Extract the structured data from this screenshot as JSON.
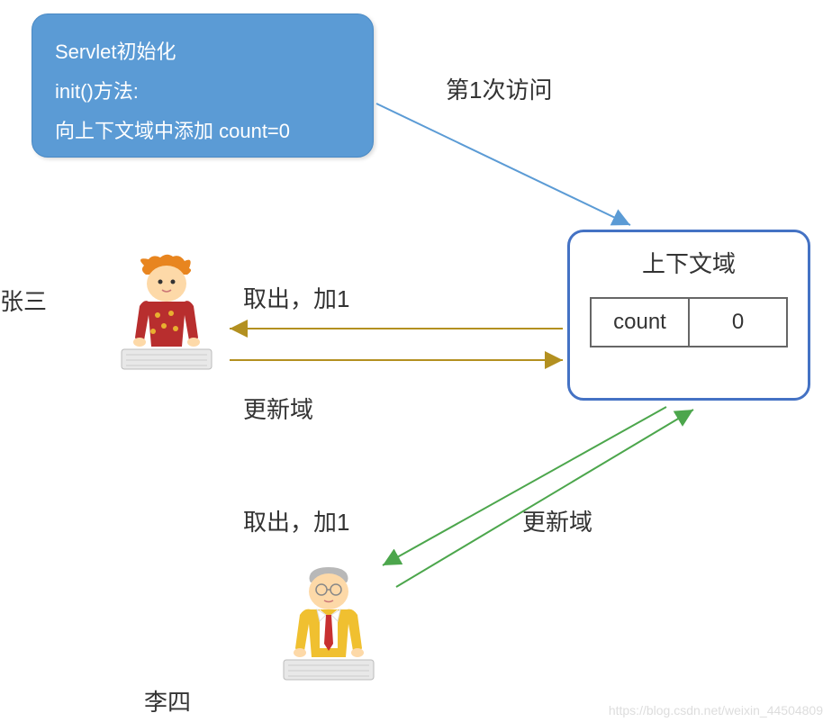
{
  "servlet": {
    "line1": "Servlet初始化",
    "line2": "init()方法:",
    "line3": "向上下文域中添加 count=0"
  },
  "context": {
    "title": "上下文域",
    "key": "count",
    "value": "0"
  },
  "labels": {
    "first_visit": "第1次访问",
    "user1_name": "张三",
    "user2_name": "李四",
    "fetch_add": "取出，加1",
    "update": "更新域"
  },
  "watermark": "https://blog.csdn.net/weixin_44504809"
}
